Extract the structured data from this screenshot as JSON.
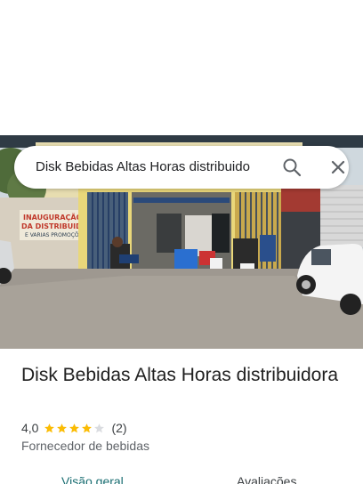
{
  "search": {
    "query": "Disk Bebidas Altas Horas distribuido",
    "search_icon": "search-icon",
    "close_icon": "close-icon"
  },
  "photo": {
    "sign_line1": "INAUGURAÇÃO",
    "sign_line2": "DA DISTRIBUIDORA",
    "sign_line3": "E VARIAS PROMOÇÕES"
  },
  "place": {
    "title": "Disk Bebidas Altas Horas distribuidora",
    "rating": "4,0",
    "stars": 4,
    "stars_max": 5,
    "reviews_count": "(2)",
    "category": "Fornecedor de bebidas"
  },
  "tabs": [
    {
      "label": "Visão geral",
      "active": true
    },
    {
      "label": "Avaliações",
      "active": false
    }
  ],
  "colors": {
    "accent": "#1a6e72",
    "star": "#fbbc04",
    "star_empty": "#dadce0"
  }
}
